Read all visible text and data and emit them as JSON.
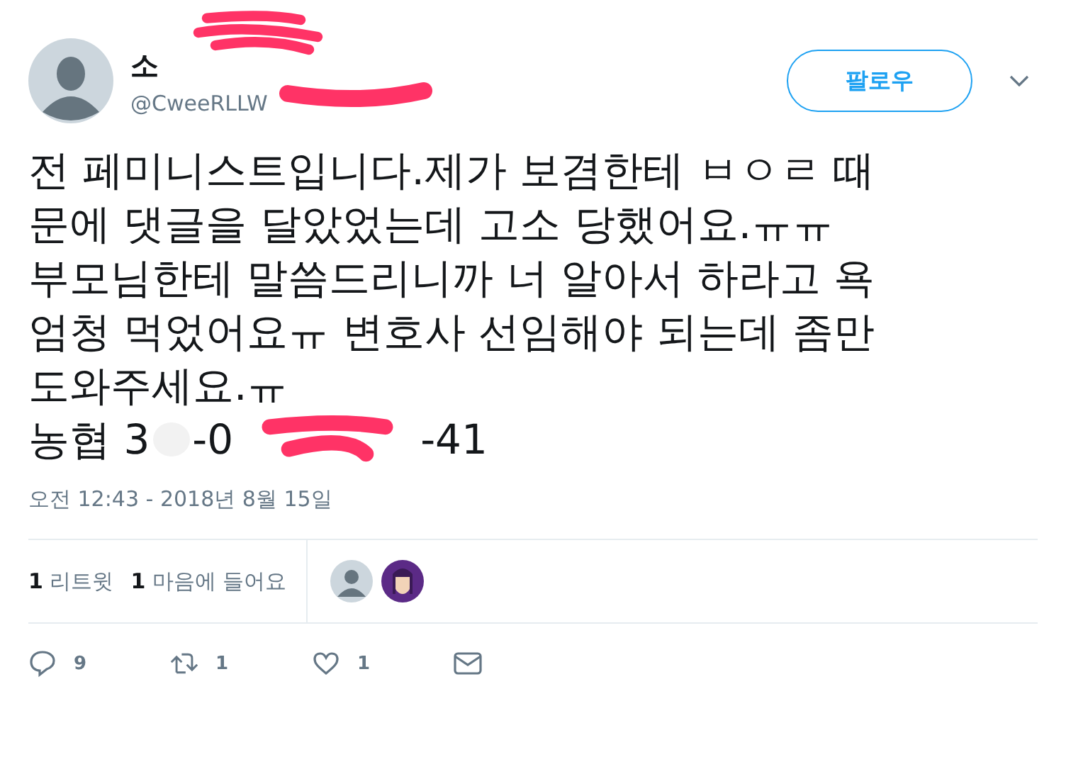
{
  "author": {
    "name": "소",
    "handle": "@CweeRLLW"
  },
  "follow_button": {
    "label": "팔로우"
  },
  "tweet_lines": [
    "전 페미니스트입니다.제가 보겸한테 ㅂㅇㄹ 때",
    "문에 댓글을 달았었는데 고소 당했어요.ㅠㅠ",
    "부모님한테 말씀드리니까 너 알아서 하라고 욕",
    "엄청 먹었어요ㅠ 변호사 선임해야 되는데 좀만",
    "도와주세요.ㅠ"
  ],
  "account_parts": [
    "농협 3",
    "-0",
    "-41"
  ],
  "timestamp": "오전 12:43 - 2018년 8월 15일",
  "stats": [
    {
      "count": "1",
      "label": "리트윗"
    },
    {
      "count": "1",
      "label": "마음에 들어요"
    }
  ],
  "actions": [
    {
      "kind": "reply",
      "count": "9"
    },
    {
      "kind": "retweet",
      "count": "1"
    },
    {
      "kind": "like",
      "count": "1"
    },
    {
      "kind": "message"
    }
  ]
}
